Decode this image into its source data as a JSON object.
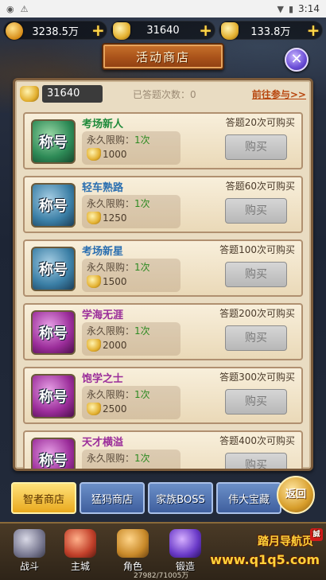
{
  "status_bar": {
    "time": "3:14",
    "warning_icon": "warning-icon",
    "wifi_icon": "wifi-icon",
    "battery_icon": "battery-icon"
  },
  "currency": [
    {
      "value": "3238.5万",
      "icon": "coin-icon"
    },
    {
      "value": "31640",
      "icon": "ingot-icon"
    },
    {
      "value": "133.8万",
      "icon": "gold-ingot-icon"
    }
  ],
  "title": "活动商店",
  "close_label": "✕",
  "panel": {
    "balance": "31640",
    "answered_count": "已答题次数：0",
    "go_link": "前往参与>>"
  },
  "items": [
    {
      "badge": "称号",
      "name": "考场新人",
      "color": "green",
      "limit_label": "永久限购：",
      "limit_value": "1次",
      "price": "1000",
      "condition": "答题20次可购买",
      "buy_label": "购买"
    },
    {
      "badge": "称号",
      "name": "轻车熟路",
      "color": "blue",
      "limit_label": "永久限购：",
      "limit_value": "1次",
      "price": "1250",
      "condition": "答题60次可购买",
      "buy_label": "购买"
    },
    {
      "badge": "称号",
      "name": "考场新星",
      "color": "blue",
      "limit_label": "永久限购：",
      "limit_value": "1次",
      "price": "1500",
      "condition": "答题100次可购买",
      "buy_label": "购买"
    },
    {
      "badge": "称号",
      "name": "学海无涯",
      "color": "purple",
      "limit_label": "永久限购：",
      "limit_value": "1次",
      "price": "2000",
      "condition": "答题200次可购买",
      "buy_label": "购买"
    },
    {
      "badge": "称号",
      "name": "饱学之士",
      "color": "purple",
      "limit_label": "永久限购：",
      "limit_value": "1次",
      "price": "2500",
      "condition": "答题300次可购买",
      "buy_label": "购买"
    },
    {
      "badge": "称号",
      "name": "天才横溢",
      "color": "purple",
      "limit_label": "永久限购：",
      "limit_value": "1次",
      "price": "",
      "condition": "答题400次可购买",
      "buy_label": "购买"
    }
  ],
  "tabs": [
    {
      "label": "智者商店",
      "active": true
    },
    {
      "label": "猛犸商店",
      "active": false
    },
    {
      "label": "家族BOSS",
      "active": false
    },
    {
      "label": "伟大宝藏",
      "active": false
    }
  ],
  "back_label": "返回",
  "nav": [
    {
      "label": "战斗",
      "icon": "swords-icon"
    },
    {
      "label": "主城",
      "icon": "castle-icon"
    },
    {
      "label": "角色",
      "icon": "helmet-icon"
    },
    {
      "label": "锻造",
      "icon": "anvil-icon"
    }
  ],
  "exp_text": "27982/71005万",
  "watermark": {
    "line1": "踏月导航页",
    "line2": "www.q1q5.com",
    "seal": "誠"
  }
}
